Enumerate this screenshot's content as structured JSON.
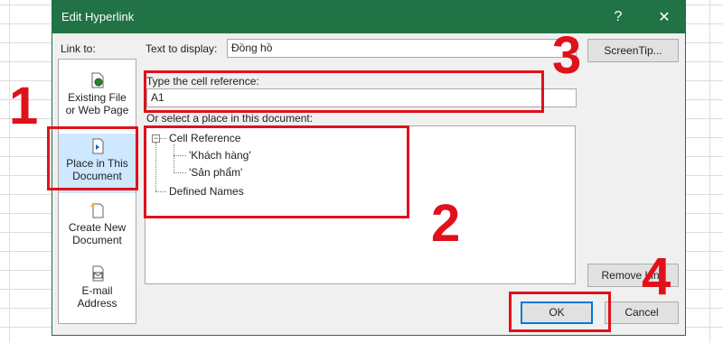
{
  "dialog": {
    "title": "Edit Hyperlink",
    "help_glyph": "?",
    "close_glyph": "✕"
  },
  "link_to": {
    "label": "Link to:",
    "items": [
      {
        "line1": "Existing File",
        "line2": "or Web Page"
      },
      {
        "line1": "Place in This",
        "line2": "Document"
      },
      {
        "line1": "Create New",
        "line2": "Document"
      },
      {
        "line1": "E-mail",
        "line2": "Address"
      }
    ]
  },
  "text_to_display": {
    "label": "Text to display:",
    "value": "Đồng hồ"
  },
  "screentip_label": "ScreenTip...",
  "cell_reference": {
    "label": "Type the cell reference:",
    "value": "A1"
  },
  "place_list": {
    "label": "Or select a place in this document:",
    "nodes": {
      "cell_reference": "Cell Reference",
      "sheet1": "'Khách hàng'",
      "sheet2": "'Sản phẩm'",
      "defined_names": "Defined Names"
    }
  },
  "buttons": {
    "remove_link": "Remove Link",
    "ok": "OK",
    "cancel": "Cancel"
  },
  "annotations": [
    "1",
    "2",
    "3",
    "4"
  ],
  "colors": {
    "titlebar": "#217346",
    "highlight": "#e0111c",
    "selected": "#cde8ff"
  }
}
